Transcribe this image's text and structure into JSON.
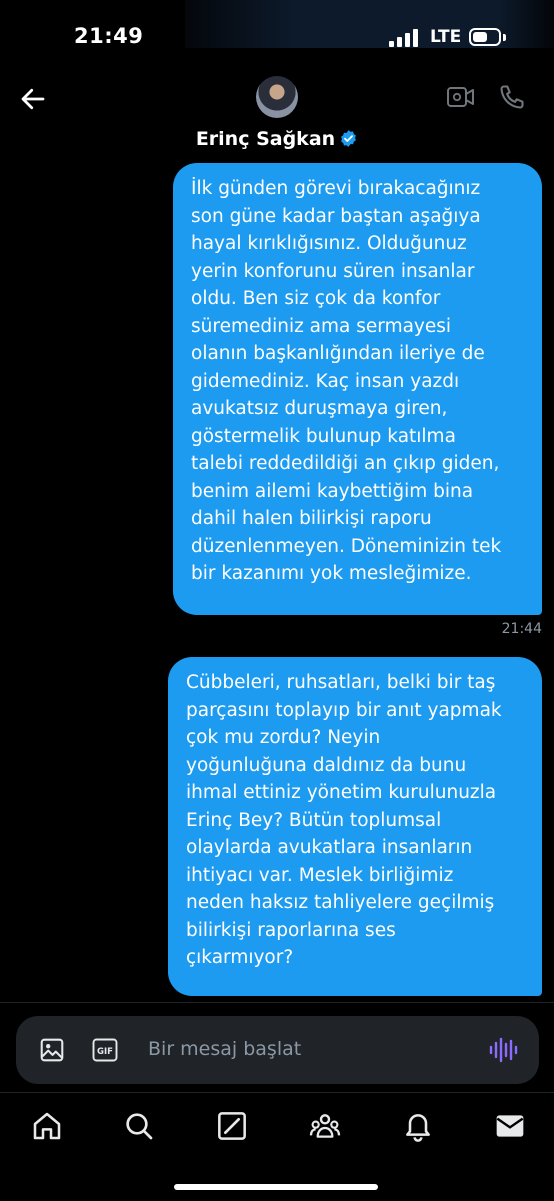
{
  "status_bar": {
    "time": "21:49",
    "network": "LTE"
  },
  "header": {
    "contact_name": "Erinç Sağkan",
    "verified": true
  },
  "messages": [
    {
      "direction": "outgoing",
      "text": "İlk günden görevi bırakacağınız\nson güne kadar baştan aşağıya\nhayal kırıklığısınız. Olduğunuz\nyerin konforunu süren insanlar\noldu. Ben siz çok da konfor\nsüremediniz ama sermayesi\nolanın başkanlığından ileriye de\ngidemediniz. Kaç insan yazdı\navukatsız duruşmaya giren,\ngöstermelik bulunup katılma\ntalebi reddedildiği an çıkıp giden,\nbenim ailemi kaybettiğim bina\ndahil halen bilirkişi raporu\ndüzenlenmeyen. Döneminizin tek\nbir kazanımı yok mesleğimize.",
      "time": "21:44"
    },
    {
      "direction": "outgoing",
      "text": "Cübbeleri, ruhsatları, belki bir taş\nparçasını toplayıp bir anıt yapmak\nçok mu zordu? Neyin\nyoğunluğuna daldınız da bunu\nihmal ettiniz yönetim kurulunuzla\nErinç Bey? Bütün toplumsal\nolaylarda avukatlara insanların\nihtiyacı var. Meslek birliğimiz\nneden haksız tahliyelere geçilmiş\nbilirkişi raporlarına ses\nçıkarmıyor?"
    }
  ],
  "composer": {
    "placeholder": "Bir mesaj başlat",
    "gif_label": "GIF"
  },
  "tabs": [
    "home-icon",
    "search-icon",
    "grok-icon",
    "communities-icon",
    "notifications-icon",
    "messages-icon"
  ],
  "colors": {
    "accent": "#1d9bf0",
    "background": "#000000",
    "composer": "#202327",
    "voice": "#8c6cff"
  }
}
